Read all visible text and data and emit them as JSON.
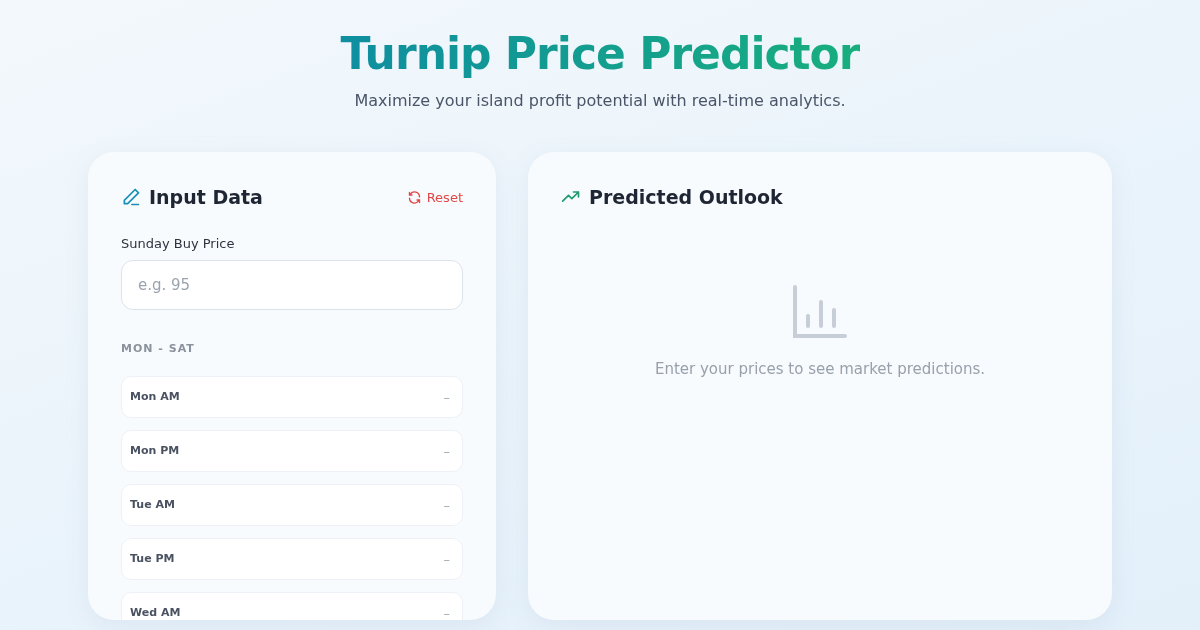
{
  "header": {
    "title": "Turnip Price Predictor",
    "subtitle": "Maximize your island profit potential with real-time analytics."
  },
  "input_panel": {
    "title": "Input Data",
    "reset_label": "Reset",
    "buy_price": {
      "label": "Sunday Buy Price",
      "placeholder": "e.g. 95"
    },
    "section_label": "MON - SAT",
    "days": [
      {
        "label": "Mon AM",
        "placeholder": "–"
      },
      {
        "label": "Mon PM",
        "placeholder": "–"
      },
      {
        "label": "Tue AM",
        "placeholder": "–"
      },
      {
        "label": "Tue PM",
        "placeholder": "–"
      },
      {
        "label": "Wed AM",
        "placeholder": "–"
      }
    ]
  },
  "outlook_panel": {
    "title": "Predicted Outlook",
    "empty_message": "Enter your prices to see market predictions."
  }
}
